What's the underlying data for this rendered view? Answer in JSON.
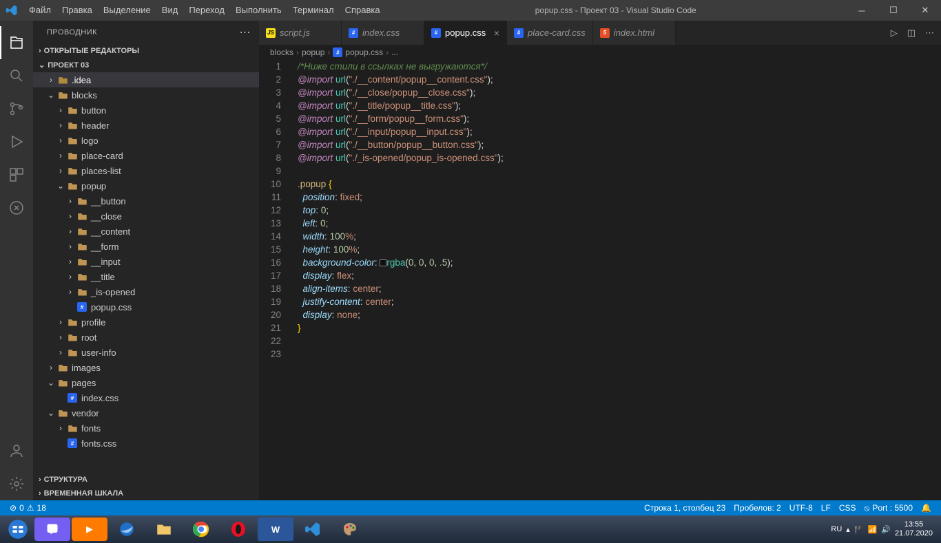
{
  "titlebar": {
    "title": "popup.css - Проект 03 - Visual Studio Code",
    "menu": [
      "Файл",
      "Правка",
      "Выделение",
      "Вид",
      "Переход",
      "Выполнить",
      "Терминал",
      "Справка"
    ]
  },
  "sidebar": {
    "title": "ПРОВОДНИК",
    "sections": {
      "open_editors": "ОТКРЫТЫЕ РЕДАКТОРЫ",
      "project": "ПРОЕКТ 03",
      "outline": "СТРУКТУРА",
      "timeline": "ВРЕМЕННАЯ ШКАЛА"
    },
    "tree": [
      {
        "d": 0,
        "t": "folder-dark",
        "chev": ">",
        "label": ".idea",
        "sel": true
      },
      {
        "d": 0,
        "t": "folder",
        "chev": "v",
        "label": "blocks"
      },
      {
        "d": 1,
        "t": "folder",
        "chev": ">",
        "label": "button"
      },
      {
        "d": 1,
        "t": "folder",
        "chev": ">",
        "label": "header"
      },
      {
        "d": 1,
        "t": "folder",
        "chev": ">",
        "label": "logo"
      },
      {
        "d": 1,
        "t": "folder",
        "chev": ">",
        "label": "place-card"
      },
      {
        "d": 1,
        "t": "folder",
        "chev": ">",
        "label": "places-list"
      },
      {
        "d": 1,
        "t": "folder",
        "chev": "v",
        "label": "popup"
      },
      {
        "d": 2,
        "t": "folder",
        "chev": ">",
        "label": "__button"
      },
      {
        "d": 2,
        "t": "folder",
        "chev": ">",
        "label": "__close"
      },
      {
        "d": 2,
        "t": "folder",
        "chev": ">",
        "label": "__content"
      },
      {
        "d": 2,
        "t": "folder",
        "chev": ">",
        "label": "__form"
      },
      {
        "d": 2,
        "t": "folder",
        "chev": ">",
        "label": "__input"
      },
      {
        "d": 2,
        "t": "folder",
        "chev": ">",
        "label": "__title"
      },
      {
        "d": 2,
        "t": "folder",
        "chev": ">",
        "label": "_is-opened"
      },
      {
        "d": 2,
        "t": "css",
        "chev": "",
        "label": "popup.css"
      },
      {
        "d": 1,
        "t": "folder",
        "chev": ">",
        "label": "profile"
      },
      {
        "d": 1,
        "t": "folder",
        "chev": ">",
        "label": "root"
      },
      {
        "d": 1,
        "t": "folder",
        "chev": ">",
        "label": "user-info"
      },
      {
        "d": 0,
        "t": "folder-img",
        "chev": ">",
        "label": "images"
      },
      {
        "d": 0,
        "t": "folder-pages",
        "chev": "v",
        "label": "pages"
      },
      {
        "d": 1,
        "t": "css",
        "chev": "",
        "label": "index.css"
      },
      {
        "d": 0,
        "t": "folder",
        "chev": "v",
        "label": "vendor"
      },
      {
        "d": 1,
        "t": "folder-fonts",
        "chev": ">",
        "label": "fonts"
      },
      {
        "d": 1,
        "t": "css",
        "chev": "",
        "label": "fonts.css"
      }
    ]
  },
  "tabs": [
    {
      "icon": "js",
      "label": "script.js",
      "active": false
    },
    {
      "icon": "css",
      "label": "index.css",
      "active": false
    },
    {
      "icon": "css",
      "label": "popup.css",
      "active": true
    },
    {
      "icon": "css",
      "label": "place-card.css",
      "active": false
    },
    {
      "icon": "html",
      "label": "index.html",
      "active": false
    }
  ],
  "breadcrumbs": [
    "blocks",
    "popup",
    "popup.css",
    "..."
  ],
  "code": {
    "lines": 23,
    "l1_comment": "/*Ниже стили в ссылках не выгружаются*/",
    "imports": [
      "\"./__content/popup__content.css\"",
      "\"./__close/popup__close.css\"",
      "\"./__title/popup__title.css\"",
      "\"./__form/popup__form.css\"",
      "\"./__input/popup__input.css\"",
      "\"./__button/popup__button.css\"",
      "\"./_is-opened/popup_is-opened.css\""
    ],
    "selector": ".popup",
    "props": [
      {
        "p": "position",
        "v": "fixed",
        "t": "kw"
      },
      {
        "p": "top",
        "v": "0",
        "t": "num"
      },
      {
        "p": "left",
        "v": "0",
        "t": "num"
      },
      {
        "p": "width",
        "v": "100%",
        "t": "pct"
      },
      {
        "p": "height",
        "v": "100%",
        "t": "pct"
      },
      {
        "p": "background-color",
        "v": "rgba(0, 0, 0, .5)",
        "t": "rgba"
      },
      {
        "p": "display",
        "v": "flex",
        "t": "kw"
      },
      {
        "p": "align-items",
        "v": "center",
        "t": "kw"
      },
      {
        "p": "justify-content",
        "v": "center",
        "t": "kw"
      },
      {
        "p": "display",
        "v": "none",
        "t": "kw"
      }
    ]
  },
  "statusbar": {
    "errors": "0",
    "warnings": "18",
    "pos": "Строка 1, столбец 23",
    "spaces": "Пробелов: 2",
    "encoding": "UTF-8",
    "eol": "LF",
    "lang": "CSS",
    "port": "Port : 5500"
  },
  "taskbar": {
    "lang": "RU",
    "time": "13:55",
    "date": "21.07.2020"
  }
}
